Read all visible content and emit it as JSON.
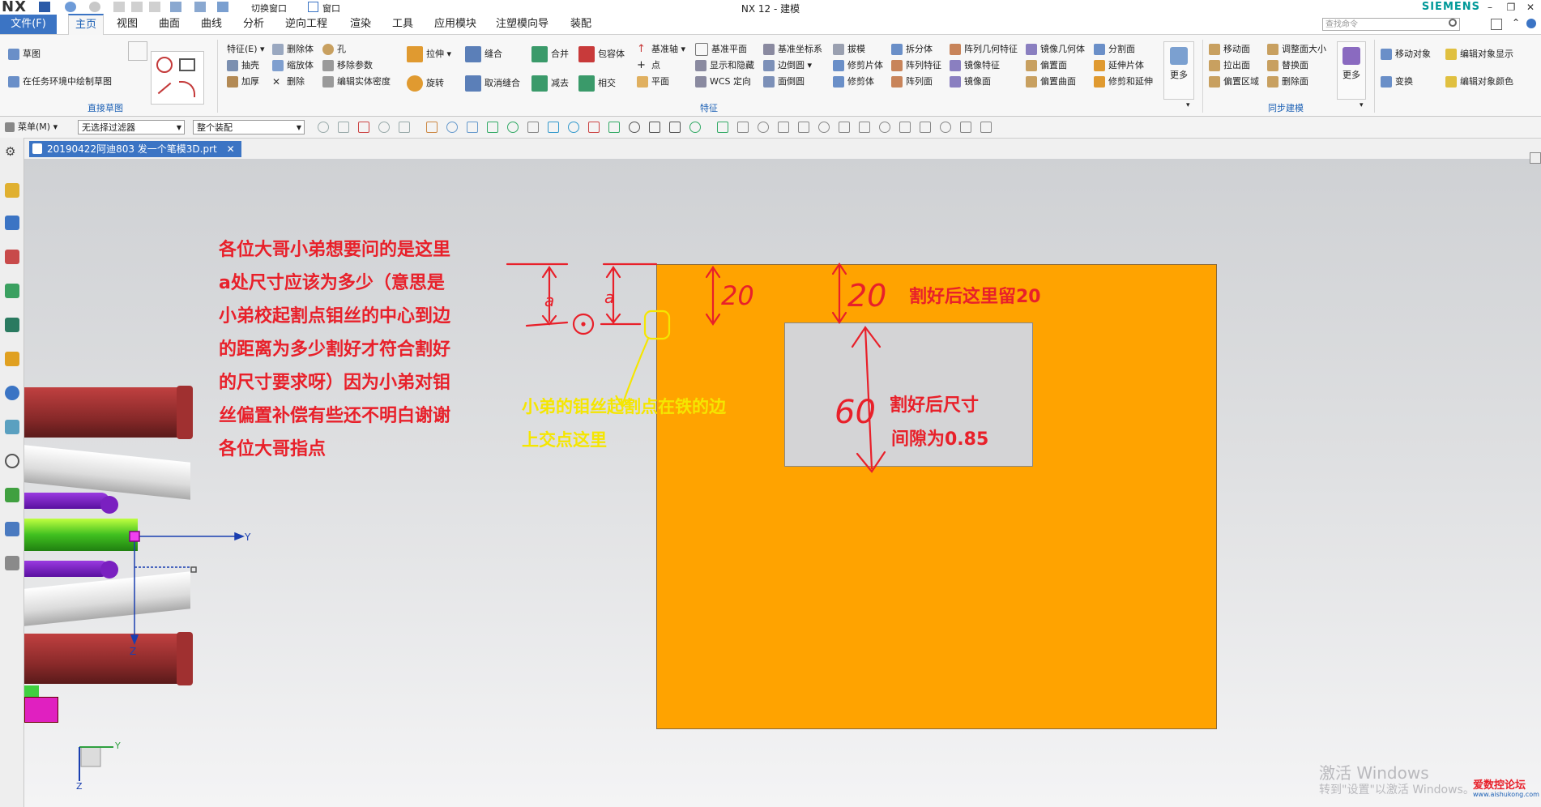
{
  "titlebar": {
    "app_logo": "NX",
    "switch_window": "切换窗口",
    "window_menu": "窗口",
    "title": "NX 12 - 建模",
    "brand": "SIEMENS",
    "minimize": "–",
    "restore": "❐",
    "close": "✕"
  },
  "menubar": {
    "file": "文件(F)",
    "tabs": [
      "主页",
      "视图",
      "曲面",
      "曲线",
      "分析",
      "逆向工程",
      "渲染",
      "工具",
      "应用模块",
      "注塑模向导",
      "装配"
    ],
    "search_placeholder": "查找命令"
  },
  "ribbon": {
    "sketch": {
      "items": [
        "草图",
        "在任务环境中绘制草图"
      ],
      "group": "直接草图"
    },
    "feature": {
      "col1": [
        "特征(E)",
        "抽壳",
        "加厚"
      ],
      "col2": [
        "删除体",
        "缩放体",
        "删除"
      ],
      "col3": [
        "孔",
        "移除参数",
        "编辑实体密度"
      ],
      "col4": [
        "拉伸",
        "旋转"
      ],
      "col5": [
        "缝合",
        "取消缝合"
      ],
      "col6": [
        "合并",
        "减去"
      ],
      "col7": [
        "包容体",
        "相交"
      ],
      "col8": [
        "基准轴",
        "点",
        "平面"
      ],
      "col9": [
        "基准平面",
        "显示和隐藏",
        "WCS 定向"
      ],
      "col10": [
        "基准坐标系",
        "边倒圆",
        "面倒圆"
      ],
      "col11": [
        "拔模",
        "修剪片体",
        "修剪体"
      ],
      "col12": [
        "拆分体",
        "阵列特征",
        "阵列面"
      ],
      "col13": [
        "阵列几何特征",
        "镜像特征",
        "镜像面"
      ],
      "col14": [
        "镜像几何体",
        "偏置面",
        "偏置曲面"
      ],
      "col15": [
        "分割面",
        "延伸片体",
        "修剪和延伸"
      ],
      "more": "更多",
      "group": "特征"
    },
    "sync": {
      "col1": [
        "移动面",
        "拉出面",
        "偏置区域"
      ],
      "col2": [
        "调整面大小",
        "替换面",
        "删除面"
      ],
      "more": "更多",
      "group": "同步建模"
    },
    "right": [
      "移动对象",
      "变换",
      "编辑对象显示",
      "编辑对象颜色"
    ]
  },
  "toolbar2": {
    "menu": "菜单(M)",
    "filter": "无选择过滤器",
    "scope": "整个装配"
  },
  "doctab": {
    "name": "20190422阿迪803 发一个笔模3D.prt",
    "close": "✕"
  },
  "annotations": {
    "question_lines": [
      "各位大哥小弟想要问的是这里",
      "a处尺寸应该为多少（意思是",
      "小弟校起割点钼丝的中心到边",
      "的距离为多少割好才符合割好",
      "的尺寸要求呀）因为小弟对钼",
      "丝偏置补偿有些还不明白谢谢",
      "各位大哥指点"
    ],
    "yellow_lines": [
      "小弟的钼丝起割点在铁的边",
      "上交点这里"
    ],
    "leave20": "割好后这里留20",
    "size_after": "割好后尺寸",
    "gap": "间隙为0.85",
    "hand_20a": "20",
    "hand_20b": "20",
    "hand_60": "60",
    "hand_a1": "a",
    "hand_a2": "a"
  },
  "axes": {
    "y": "Y",
    "z": "Z",
    "y2": "Y",
    "z2": "Z"
  },
  "watermark": {
    "line1": "激活 Windows",
    "line2": "转到\"设置\"以激活 Windows。",
    "forum": "爱数控论坛",
    "forum_url": "www.aishukong.com"
  },
  "colors": {
    "workpiece": "#ffa300",
    "annotation_red": "#e8202a",
    "annotation_yellow": "#f5e600",
    "accent_blue": "#3b74c4"
  }
}
